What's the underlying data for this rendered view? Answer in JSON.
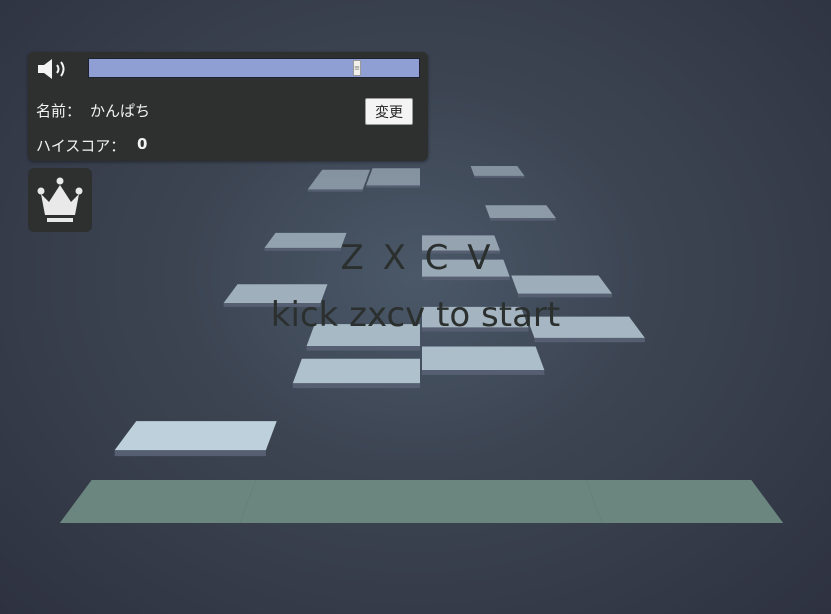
{
  "colors": {
    "tile_far": "#7f8c99",
    "tile_near": "#c3d7e2",
    "tile_side": "#565f72",
    "hit_lane": "#6e8a82",
    "panel_bg": "#2d302e",
    "slider_fill": "#8f9fd4",
    "hint_text": "#2b302f"
  },
  "volume": {
    "icon": "speaker-icon",
    "level": 0.82
  },
  "player": {
    "name_label": "名前：",
    "name": "かんぱち",
    "change_label": "変更"
  },
  "highscore": {
    "label": "ハイスコア：",
    "value": "0"
  },
  "ranking": {
    "icon": "crown-icon"
  },
  "hint": {
    "keys": "Z X C V",
    "start": "kick zxcv to start"
  },
  "lanes": [
    "Z",
    "X",
    "C",
    "V"
  ],
  "tiles": [
    {
      "lane": 0,
      "row": 0.18
    },
    {
      "lane": 1,
      "row": 0.66
    },
    {
      "lane": 1,
      "row": 0.99
    },
    {
      "lane": 2,
      "row": 0.77
    },
    {
      "lane": 2,
      "row": 1.18
    },
    {
      "lane": 2,
      "row": 1.82
    },
    {
      "lane": 2,
      "row": 2.26
    },
    {
      "lane": 3,
      "row": 1.07
    },
    {
      "lane": 3,
      "row": 1.58
    },
    {
      "lane": 3,
      "row": 3.0
    },
    {
      "lane": 3,
      "row": 4.84
    },
    {
      "lane": 0,
      "row": 1.46
    },
    {
      "lane": 0,
      "row": 2.31
    },
    {
      "lane": 0,
      "row": 4.04
    },
    {
      "lane": 0,
      "row": 4.56
    },
    {
      "lane": 1,
      "row": 4.24
    },
    {
      "lane": 1,
      "row": 4.67
    }
  ]
}
